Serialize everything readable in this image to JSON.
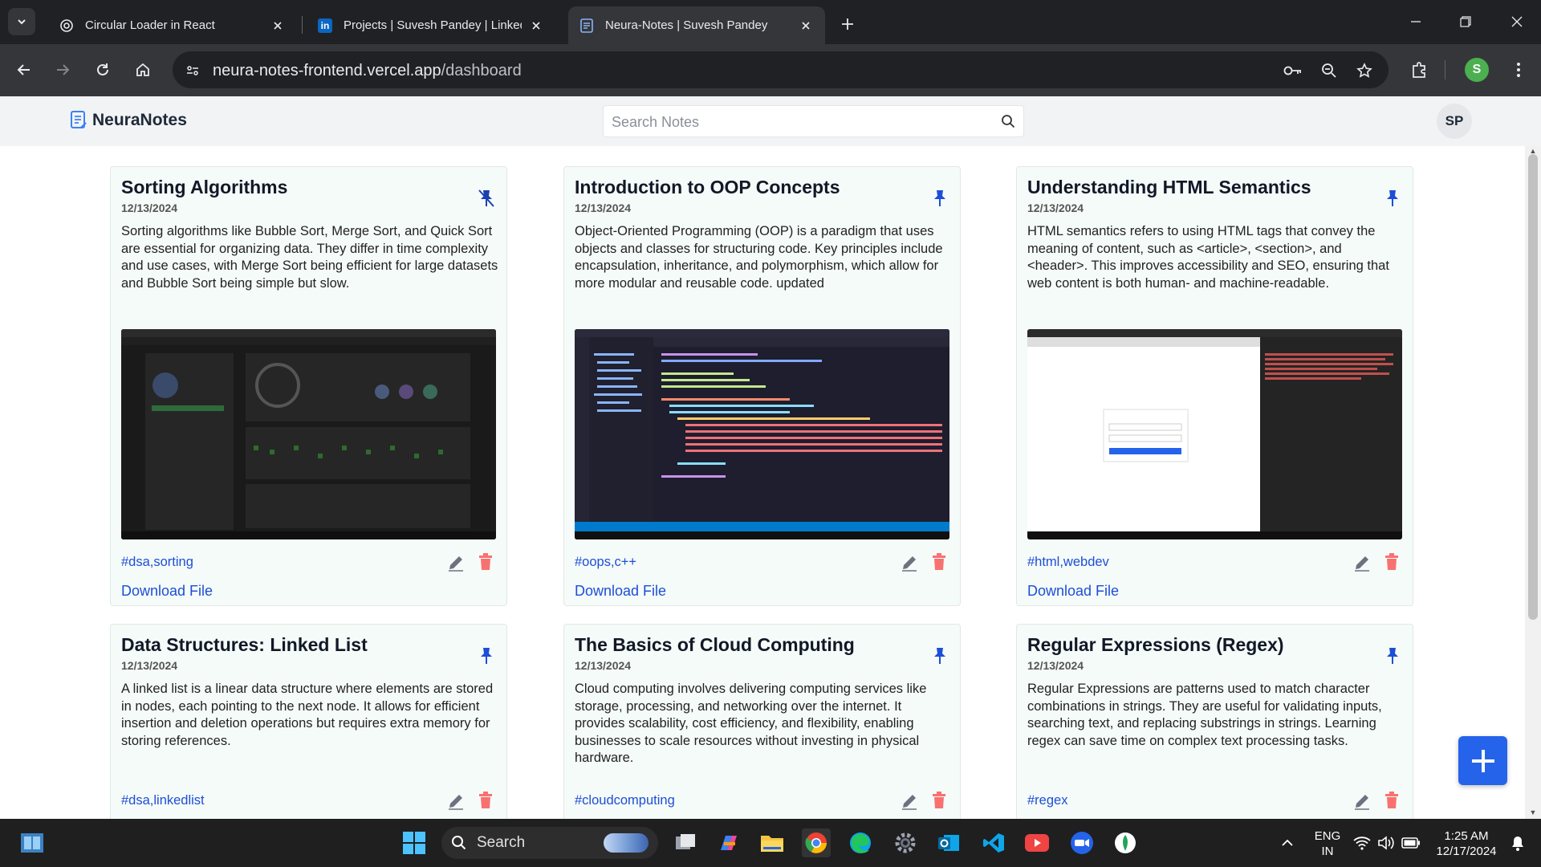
{
  "browser": {
    "tabs": [
      {
        "title": "Circular Loader in React",
        "active": false
      },
      {
        "title": "Projects | Suvesh Pandey | LinkedIn",
        "active": false
      },
      {
        "title": "Neura-Notes | Suvesh Pandey",
        "active": true
      }
    ],
    "url_host": "neura-notes-frontend.vercel.app",
    "url_path": "/dashboard",
    "profile_initial": "S"
  },
  "app": {
    "logo_text": "NeuraNotes",
    "search_placeholder": "Search Notes",
    "avatar_initials": "SP",
    "accent_color": "#2563eb",
    "delete_color": "#f87171"
  },
  "notes": [
    {
      "title": "Sorting Algorithms",
      "date": "12/13/2024",
      "content": "Sorting algorithms like Bubble Sort, Merge Sort, and Quick Sort are essential for organizing data. They differ in time complexity and use cases, with Merge Sort being efficient for large datasets and Bubble Sort being simple but slow.",
      "tags": "#dsa,sorting",
      "pinned": false,
      "has_file": true,
      "download_label": "Download File"
    },
    {
      "title": "Introduction to OOP Concepts",
      "date": "12/13/2024",
      "content": "Object-Oriented Programming (OOP) is a paradigm that uses objects and classes for structuring code. Key principles include encapsulation, inheritance, and polymorphism, which allow for more modular and reusable code. updated",
      "tags": "#oops,c++",
      "pinned": true,
      "has_file": true,
      "download_label": "Download File"
    },
    {
      "title": "Understanding HTML Semantics",
      "date": "12/13/2024",
      "content": "HTML semantics refers to using HTML tags that convey the meaning of content, such as <article>, <section>, and <header>. This improves accessibility and SEO, ensuring that web content is both human- and machine-readable.",
      "tags": "#html,webdev",
      "pinned": true,
      "has_file": true,
      "download_label": "Download File"
    },
    {
      "title": "Data Structures: Linked List",
      "date": "12/13/2024",
      "content": "A linked list is a linear data structure where elements are stored in nodes, each pointing to the next node. It allows for efficient insertion and deletion operations but requires extra memory for storing references.",
      "tags": "#dsa,linkedlist",
      "pinned": true,
      "has_file": false
    },
    {
      "title": "The Basics of Cloud Computing",
      "date": "12/13/2024",
      "content": "Cloud computing involves delivering computing services like storage, processing, and networking over the internet. It provides scalability, cost efficiency, and flexibility, enabling businesses to scale resources without investing in physical hardware.",
      "tags": "#cloudcomputing",
      "pinned": true,
      "has_file": false
    },
    {
      "title": "Regular Expressions (Regex)",
      "date": "12/13/2024",
      "content": "Regular Expressions are patterns used to match character combinations in strings. They are useful for validating inputs, searching text, and replacing substrings in strings. Learning regex can save time on complex text processing tasks.",
      "tags": "#regex",
      "pinned": true,
      "has_file": false
    }
  ],
  "taskbar": {
    "search_label": "Search",
    "lang_line1": "ENG",
    "lang_line2": "IN",
    "time": "1:25 AM",
    "date": "12/17/2024",
    "apps": [
      "windows-start",
      "task-view",
      "copilot",
      "file-explorer",
      "chrome",
      "edge",
      "settings",
      "outlook",
      "vscode",
      "youtube",
      "zoom",
      "mongodb-compass"
    ]
  }
}
